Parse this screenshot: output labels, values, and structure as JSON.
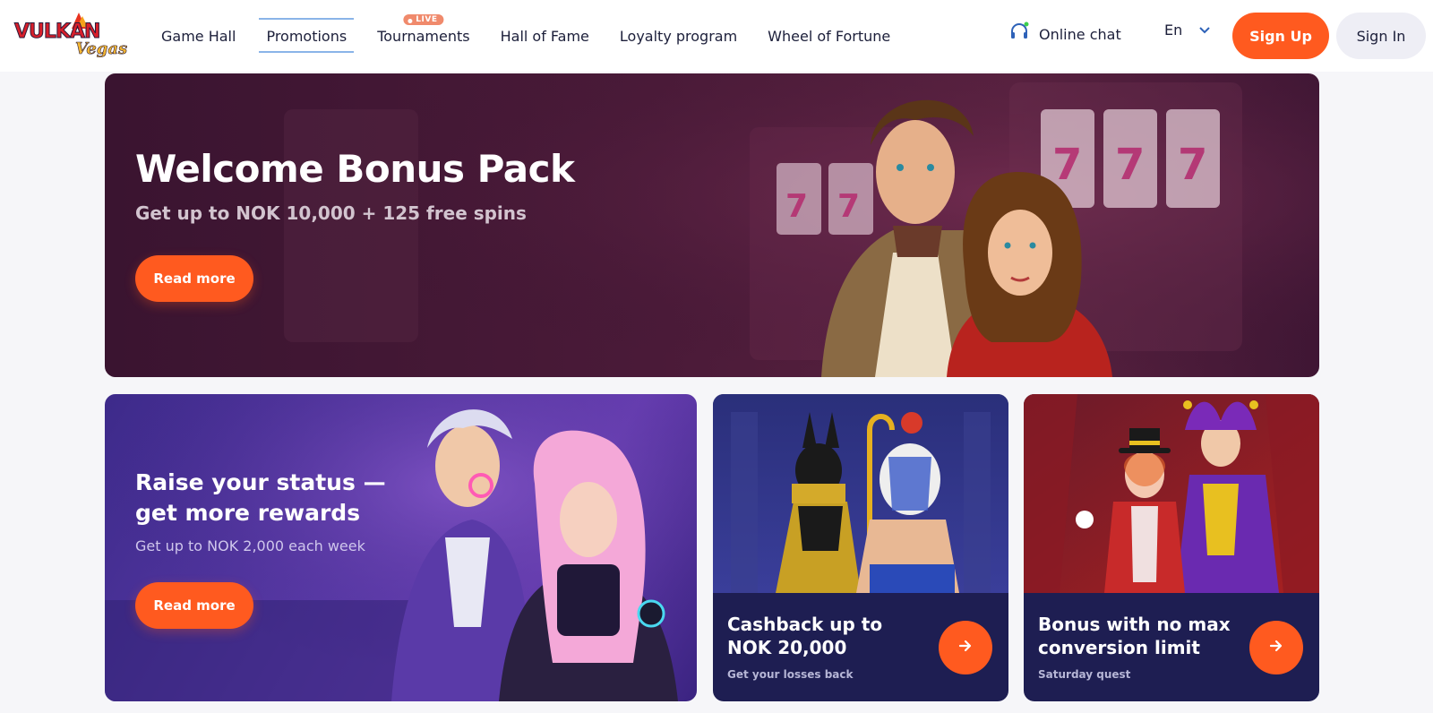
{
  "brand": {
    "logo_text": "VULKAN",
    "logo_sub": "Vegas",
    "accent": "#ff5a1f",
    "dark_text": "#1c1f3a"
  },
  "nav": {
    "items": [
      {
        "label": "Game Hall"
      },
      {
        "label": "Promotions",
        "active": true
      },
      {
        "label": "Tournaments",
        "badge": "LIVE"
      },
      {
        "label": "Hall of Fame"
      },
      {
        "label": "Loyalty program"
      },
      {
        "label": "Wheel of Fortune"
      }
    ]
  },
  "header": {
    "chat_label": "Online chat",
    "chat_icon": "headset-icon",
    "language": "En",
    "signup_label": "Sign Up",
    "signin_label": "Sign In"
  },
  "hero": {
    "title": "Welcome Bonus Pack",
    "subtitle": "Get up to NOK 10,000 + 125 free spins",
    "button_label": "Read more"
  },
  "status_card": {
    "title": "Raise your status — get more rewards",
    "subtitle": "Get up to NOK 2,000 each week",
    "button_label": "Read more"
  },
  "cashback_card": {
    "title": "Cashback up to NOK 20,000",
    "subtitle": "Get your losses back"
  },
  "quest_card": {
    "title": "Bonus with no max conversion limit",
    "subtitle": "Saturday quest"
  }
}
